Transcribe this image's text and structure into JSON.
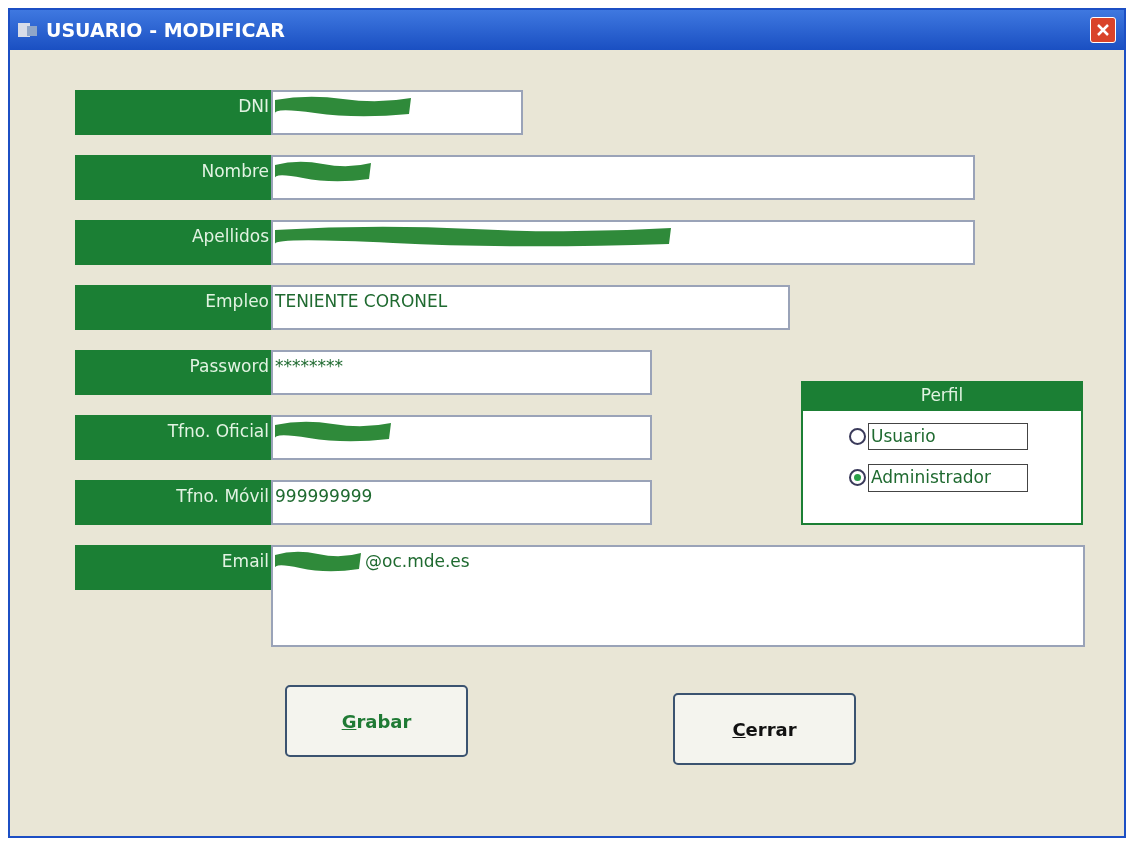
{
  "window": {
    "title": "USUARIO - MODIFICAR"
  },
  "fields": [
    {
      "label": "DNI",
      "redacted": true
    },
    {
      "label": "Nombre",
      "redacted": true
    },
    {
      "label": "Apellidos",
      "redacted": true
    },
    {
      "label": "Empleo",
      "value": "TENIENTE CORONEL",
      "redacted": false
    },
    {
      "label": "Password",
      "value": "********",
      "redacted": false
    },
    {
      "label": "Tfno. Oficial",
      "redacted": true
    },
    {
      "label": "Tfno. Móvil",
      "value": "999999999",
      "redacted": false
    },
    {
      "label": "Email",
      "value": "@oc.mde.es",
      "redacted": true
    }
  ],
  "perfil": {
    "title": "Perfil",
    "options": [
      {
        "label": "Usuario",
        "selected": false
      },
      {
        "label": "Administrador",
        "selected": true
      }
    ]
  },
  "buttons": [
    {
      "label": "Grabar",
      "color": "#1f7a34"
    },
    {
      "label": "Cerrar",
      "color": "#111111"
    }
  ]
}
